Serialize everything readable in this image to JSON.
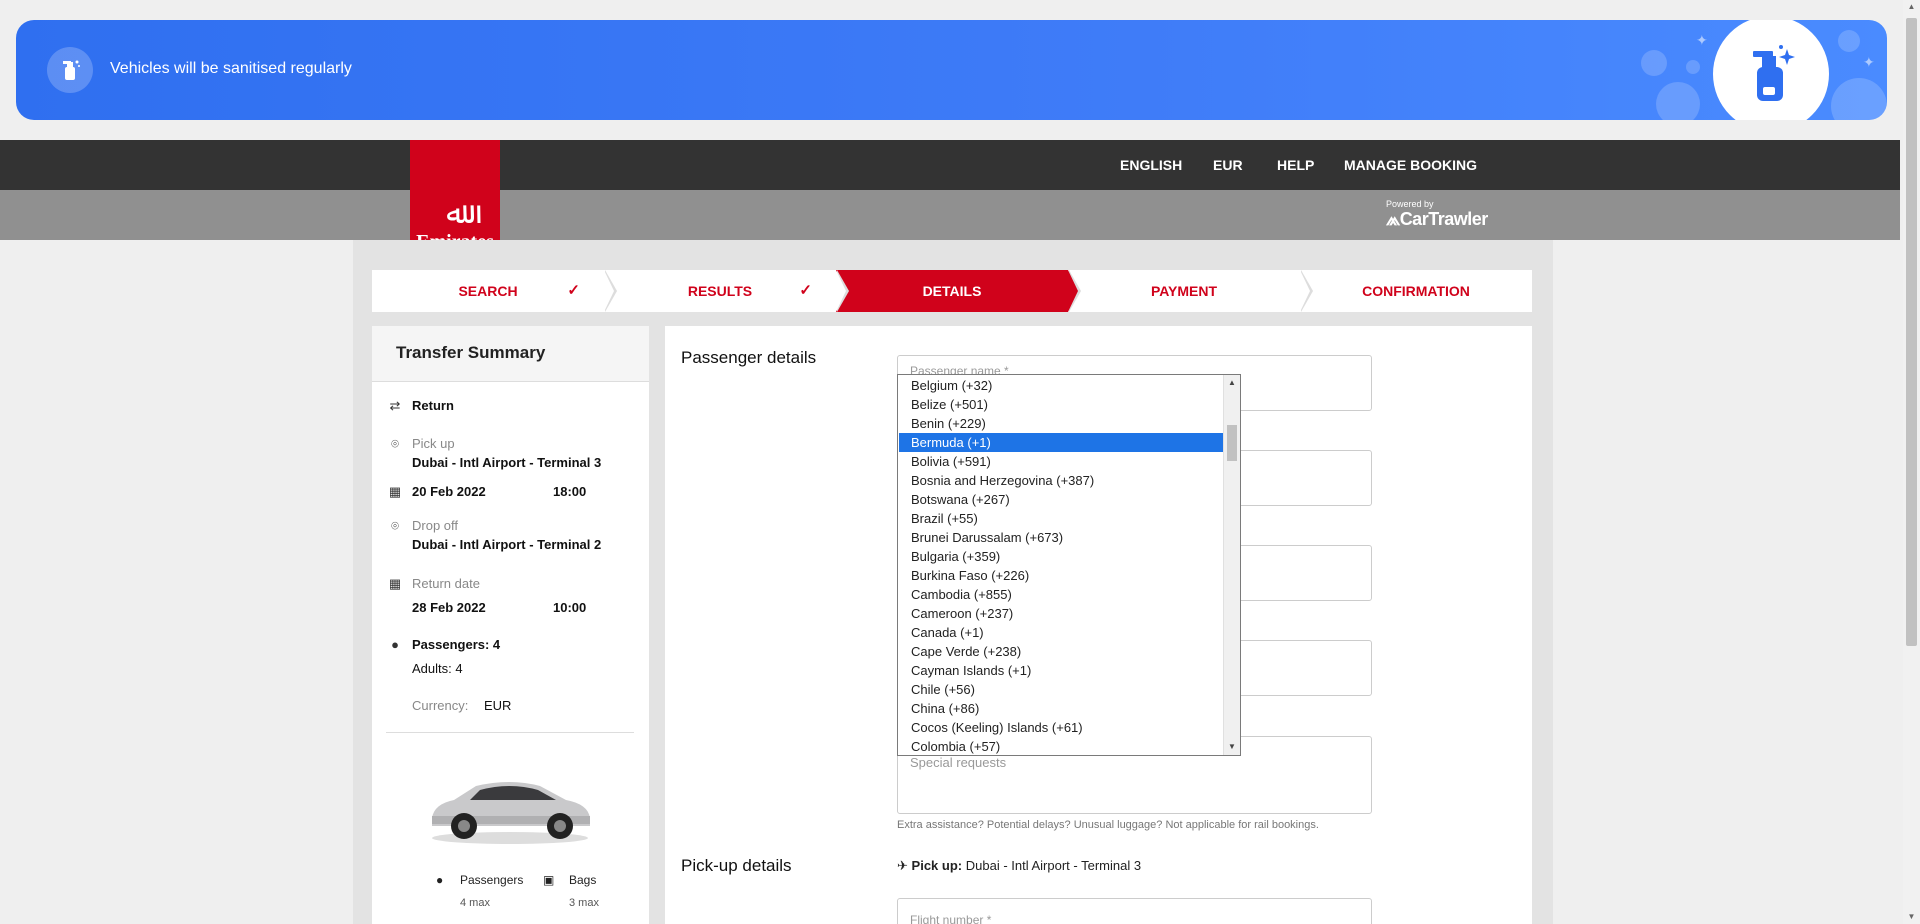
{
  "banner": {
    "text": "Vehicles will be sanitised regularly",
    "icon": "sanitiser-spray-icon"
  },
  "header": {
    "nav": [
      "ENGLISH",
      "EUR",
      "HELP",
      "MANAGE BOOKING"
    ],
    "logo_text": "Emirates",
    "powered_by": "Powered by",
    "powered_brand": "CarTrawler"
  },
  "steps": [
    {
      "label": "SEARCH",
      "done": true
    },
    {
      "label": "RESULTS",
      "done": true
    },
    {
      "label": "DETAILS",
      "active": true
    },
    {
      "label": "PAYMENT"
    },
    {
      "label": "CONFIRMATION"
    }
  ],
  "summary": {
    "title": "Transfer Summary",
    "trip_type": "Return",
    "pickup_label": "Pick up",
    "pickup_value": "Dubai - Intl Airport - Terminal 3",
    "pickup_date": "20 Feb 2022",
    "pickup_time": "18:00",
    "dropoff_label": "Drop off",
    "dropoff_value": "Dubai - Intl Airport - Terminal 2",
    "return_label": "Return date",
    "return_date": "28 Feb 2022",
    "return_time": "10:00",
    "passengers": "Passengers: 4",
    "adults": "Adults: 4",
    "currency_label": "Currency:",
    "currency_value": "EUR",
    "car_passengers_label": "Passengers",
    "car_passengers_value": "4 max",
    "car_bags_label": "Bags",
    "car_bags_value": "3 max"
  },
  "main": {
    "passenger_title": "Passenger details",
    "name_placeholder": "Passenger name *",
    "special_placeholder": "Special requests",
    "hint": "Extra assistance? Potential delays? Unusual luggage? Not applicable for rail bookings.",
    "pickup_title": "Pick-up details",
    "pickup_label": "Pick up:",
    "pickup_value": "Dubai - Intl Airport - Terminal 3",
    "flight_placeholder": "Flight number *"
  },
  "dropdown": {
    "selected": "Bermuda (+1)",
    "options": [
      "Belgium (+32)",
      "Belize (+501)",
      "Benin (+229)",
      "Bermuda (+1)",
      "Bolivia (+591)",
      "Bosnia and Herzegovina (+387)",
      "Botswana (+267)",
      "Brazil (+55)",
      "Brunei Darussalam (+673)",
      "Bulgaria (+359)",
      "Burkina Faso (+226)",
      "Cambodia (+855)",
      "Cameroon (+237)",
      "Canada (+1)",
      "Cape Verde (+238)",
      "Cayman Islands (+1)",
      "Chile (+56)",
      "China (+86)",
      "Cocos (Keeling) Islands (+61)",
      "Colombia (+57)"
    ]
  },
  "colors": {
    "brand_red": "#d0021b",
    "banner_blue": "#3f7cf8",
    "header_dark": "#333333",
    "selection_blue": "#1e74e6"
  }
}
